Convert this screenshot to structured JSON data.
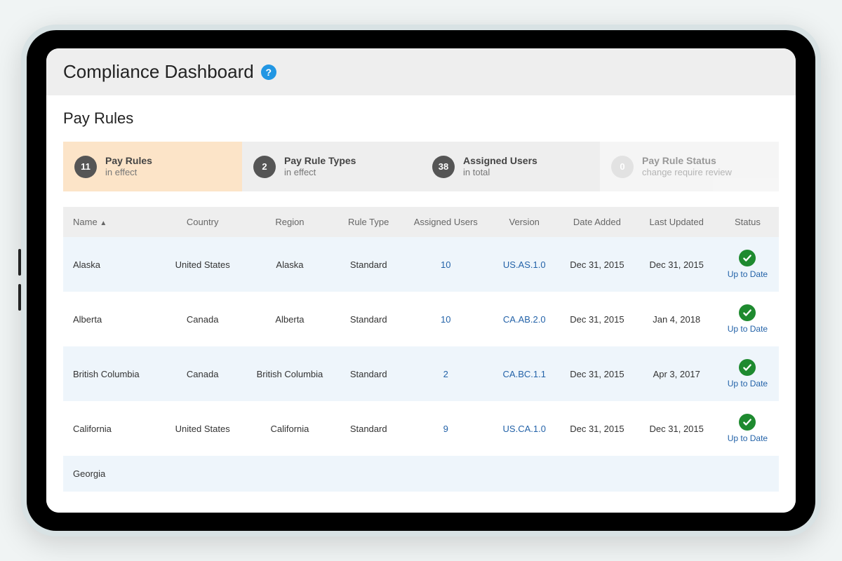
{
  "header": {
    "title": "Compliance Dashboard"
  },
  "section": {
    "title": "Pay Rules"
  },
  "stats": [
    {
      "count": "11",
      "title": "Pay Rules",
      "sub": "in effect"
    },
    {
      "count": "2",
      "title": "Pay Rule Types",
      "sub": "in effect"
    },
    {
      "count": "38",
      "title": "Assigned Users",
      "sub": "in total"
    },
    {
      "count": "0",
      "title": "Pay Rule Status",
      "sub": "change require review"
    }
  ],
  "columns": {
    "name": "Name",
    "sort_indicator": "▲",
    "country": "Country",
    "region": "Region",
    "rule_type": "Rule Type",
    "assigned_users": "Assigned Users",
    "version": "Version",
    "date_added": "Date Added",
    "last_updated": "Last Updated",
    "status": "Status"
  },
  "rows": [
    {
      "name": "Alaska",
      "country": "United States",
      "region": "Alaska",
      "rule_type": "Standard",
      "assigned_users": "10",
      "version": "US.AS.1.0",
      "date_added": "Dec 31, 2015",
      "last_updated": "Dec 31, 2015",
      "status": "Up to Date"
    },
    {
      "name": "Alberta",
      "country": "Canada",
      "region": "Alberta",
      "rule_type": "Standard",
      "assigned_users": "10",
      "version": "CA.AB.2.0",
      "date_added": "Dec 31, 2015",
      "last_updated": "Jan 4, 2018",
      "status": "Up to Date"
    },
    {
      "name": "British Columbia",
      "country": "Canada",
      "region": "British Columbia",
      "rule_type": "Standard",
      "assigned_users": "2",
      "version": "CA.BC.1.1",
      "date_added": "Dec 31, 2015",
      "last_updated": "Apr 3, 2017",
      "status": "Up to Date"
    },
    {
      "name": "California",
      "country": "United States",
      "region": "California",
      "rule_type": "Standard",
      "assigned_users": "9",
      "version": "US.CA.1.0",
      "date_added": "Dec 31, 2015",
      "last_updated": "Dec 31, 2015",
      "status": "Up to Date"
    },
    {
      "name": "Georgia",
      "country": "",
      "region": "",
      "rule_type": "",
      "assigned_users": "",
      "version": "",
      "date_added": "",
      "last_updated": "",
      "status": ""
    }
  ],
  "colors": {
    "accent_blue": "#2362a8",
    "status_green": "#1e8a2f",
    "active_card": "#fce4c8"
  }
}
